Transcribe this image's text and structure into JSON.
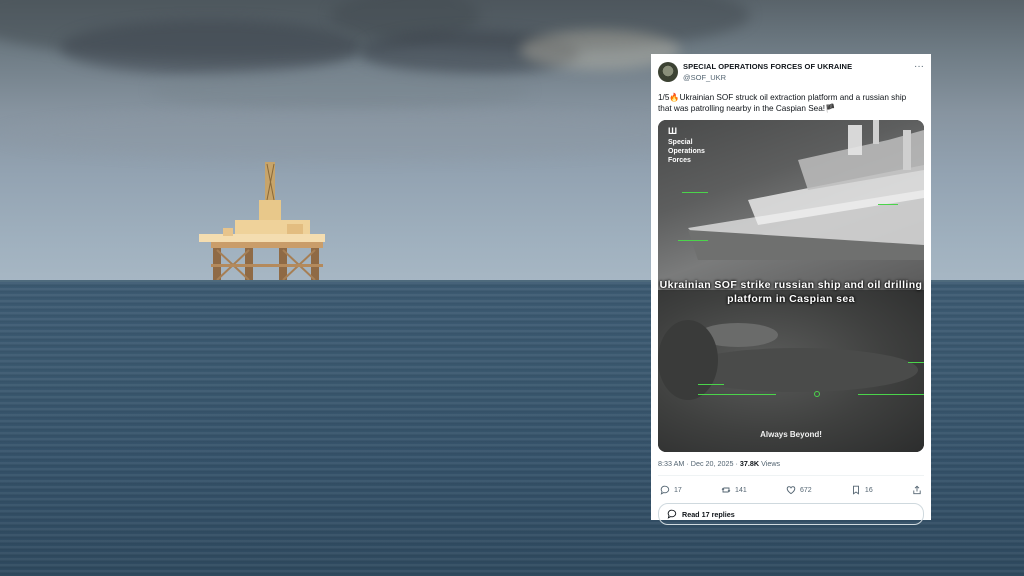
{
  "tweet": {
    "display_name": "SPECIAL OPERATIONS FORCES OF UKRAINE",
    "handle": "@SOF_UKR",
    "more_icon": "more-icon",
    "text": "1/5🔥Ukrainian SOF struck oil extraction platform and a russian ship that was patrolling nearby in the Caspian Sea!🏴",
    "media": {
      "logo": "Ш",
      "label": "Special Operations Forces",
      "caption": "Ukrainian SOF strike russian ship and oil drilling platform in Caspian sea",
      "motto": "Always Beyond!"
    },
    "time": "8:33 AM · Dec 20, 2025 · ",
    "views_count": "37.8K",
    "views_label": " Views",
    "actions": {
      "replies": "17",
      "reposts": "141",
      "likes": "672",
      "bookmarks": "16"
    },
    "read_replies": "Read 17 replies"
  },
  "colors": {
    "text": "#0f1419",
    "muted": "#536471",
    "hud": "#4bd44b"
  }
}
